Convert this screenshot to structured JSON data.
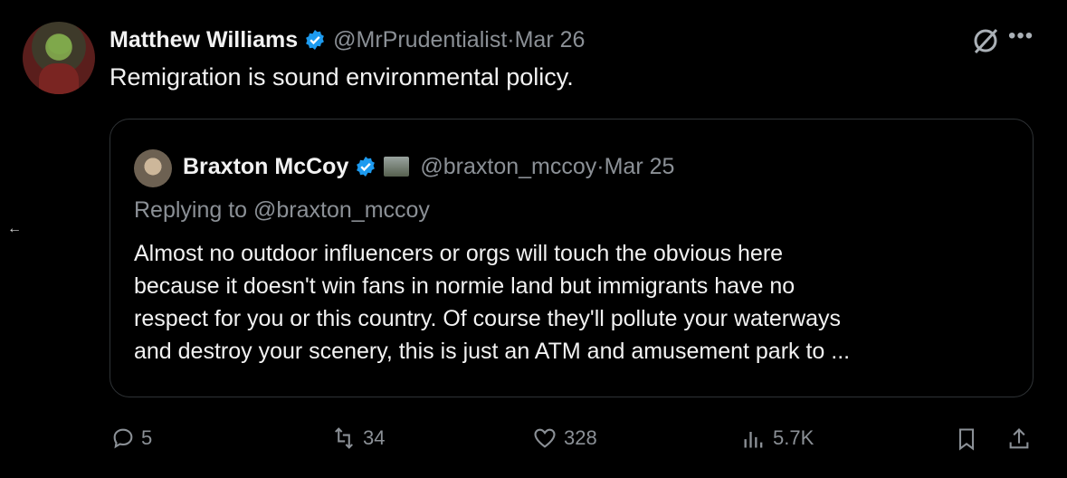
{
  "tweet": {
    "author_name": "Matthew Williams",
    "handle": "@MrPrudentialist",
    "separator": " · ",
    "date": "Mar 26",
    "text": "Remigration is sound environmental policy."
  },
  "quoted": {
    "author_name": "Braxton McCoy",
    "handle": "@braxton_mccoy",
    "separator": " · ",
    "date": "Mar 25",
    "replying_to": "Replying to @braxton_mccoy",
    "text": "Almost no outdoor influencers or orgs will touch the obvious here\nbecause it doesn't win fans in normie land but immigrants have no\nrespect for you or this country. Of course they'll pollute your waterways\nand destroy your scenery, this is just an ATM and amusement park to ..."
  },
  "actions": {
    "replies": "5",
    "reposts": "34",
    "likes": "328",
    "views": "5.7K"
  },
  "colors": {
    "background": "#000000",
    "verified": "#1d9bf0",
    "muted": "#8b9096",
    "text": "#f2f2f2"
  },
  "icons": [
    "back-arrow-icon",
    "verified-icon",
    "grok-icon",
    "more-icon",
    "reply-icon",
    "repost-icon",
    "like-icon",
    "views-icon",
    "bookmark-icon",
    "share-icon"
  ]
}
